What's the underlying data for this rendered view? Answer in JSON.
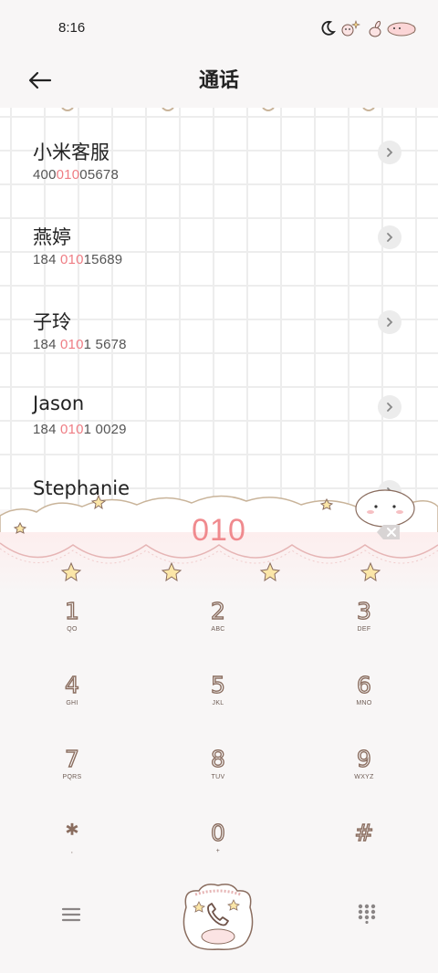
{
  "status_bar": {
    "time": "8:16",
    "icons": [
      "moon-icon",
      "sparkle-sticker-icon",
      "bunny-sticker-icon",
      "battery-icon"
    ]
  },
  "header": {
    "title": "通话",
    "back_icon": "arrow-left-icon"
  },
  "results": [
    {
      "name": "小米客服",
      "number_pre": "400",
      "number_match": "010",
      "number_post": "05678"
    },
    {
      "name": "燕婷",
      "number_pre": "184 ",
      "number_match": "010",
      "number_post": "15689"
    },
    {
      "name": "子玲",
      "number_pre": "184 ",
      "number_match": "010",
      "number_post": "1 5678"
    },
    {
      "name": "Jason",
      "number_pre": "184 ",
      "number_match": "010",
      "number_post": "1 0029"
    },
    {
      "name": "Stephanie",
      "number_pre": "",
      "number_match": "",
      "number_post": ""
    }
  ],
  "dial_input": {
    "value": "010",
    "delete_icon": "backspace-icon"
  },
  "keypad": [
    {
      "digit": "1",
      "letters": "QO"
    },
    {
      "digit": "2",
      "letters": "ABC"
    },
    {
      "digit": "3",
      "letters": "DEF"
    },
    {
      "digit": "4",
      "letters": "GHI"
    },
    {
      "digit": "5",
      "letters": "JKL"
    },
    {
      "digit": "6",
      "letters": "MNO"
    },
    {
      "digit": "7",
      "letters": "PQRS"
    },
    {
      "digit": "8",
      "letters": "TUV"
    },
    {
      "digit": "9",
      "letters": "WXYZ"
    },
    {
      "digit": "*",
      "letters": ","
    },
    {
      "digit": "0",
      "letters": "+"
    },
    {
      "digit": "#",
      "letters": ""
    }
  ],
  "bottom_bar": {
    "menu_icon": "menu-icon",
    "call_icon": "phone-icon",
    "dialpad_icon": "dialpad-icon"
  },
  "colors": {
    "accent_pink": "#ef7d84",
    "display_pink": "#f08a8e",
    "key_outline": "#8a6d5f",
    "grid_line": "#ededed",
    "background": "#f8f6f6"
  }
}
